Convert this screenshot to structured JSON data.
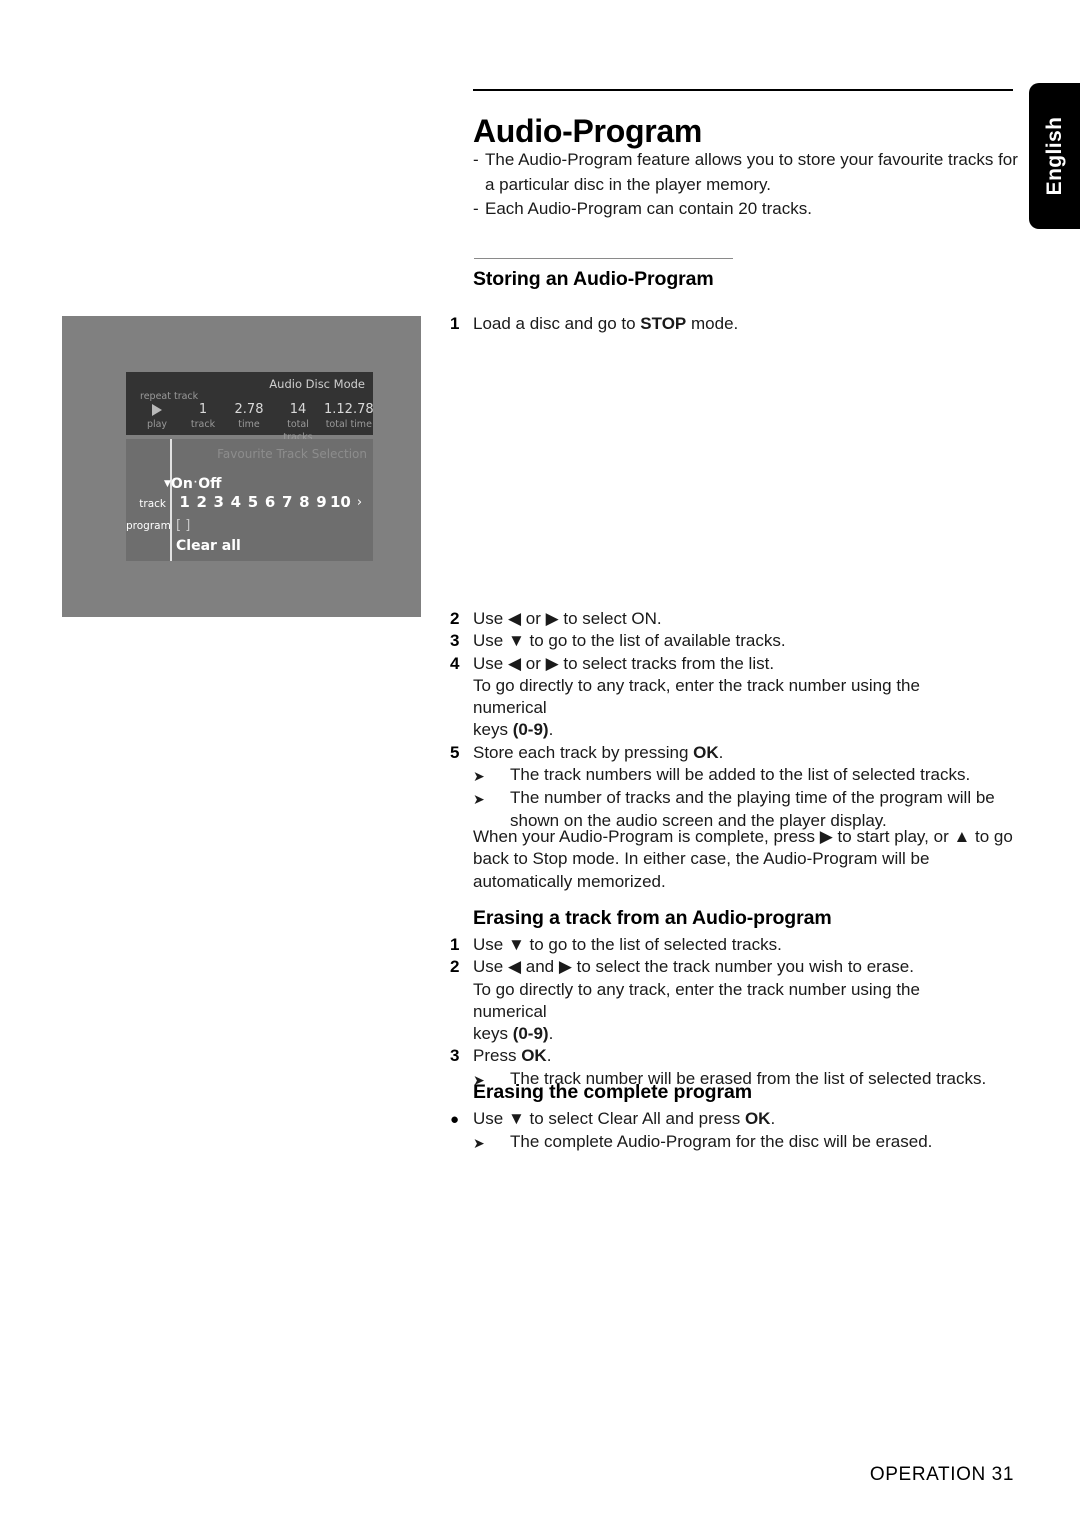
{
  "side_tab": {
    "language": "English"
  },
  "page": {
    "title": "Audio-Program",
    "footer": "OPERATION 31"
  },
  "intro": {
    "bullets": [
      "The Audio-Program feature allows you to store your favourite tracks for a particular disc in the player memory.",
      "Each Audio-Program can contain 20 tracks."
    ],
    "dash": "-"
  },
  "sections": {
    "storing": {
      "heading": "Storing an Audio-Program",
      "steps": [
        {
          "num": "1",
          "text": "Load a disc and go to STOP mode."
        },
        {
          "num": "2",
          "text": "Use ◀ or ▶ to select ON."
        },
        {
          "num": "3",
          "text": "Use ▼ to go to the list of available tracks."
        },
        {
          "num": "4",
          "text": "Use ◀ or ▶ to select tracks from the list."
        },
        {
          "num": "5",
          "text": "Store each track by pressing OK."
        }
      ],
      "step4_continuation_a": "To go directly to any track, enter the track number using the numerical",
      "step4_continuation_b": "keys (0-9).",
      "results": [
        "The track numbers will be added to the list of selected tracks.",
        "The number of tracks and the playing time of the program will be shown on the audio screen and the player display."
      ],
      "note": "When your Audio-Program is complete, press ▶ to start play, or ▲ to go back to Stop mode. In either case, the Audio-Program will be automatically memorized."
    },
    "erasing_track": {
      "heading": "Erasing a track from an Audio-program",
      "steps": [
        {
          "num": "1",
          "text": "Use ▼ to go to the list of selected tracks."
        },
        {
          "num": "2",
          "text": "Use ◀ and ▶ to select the track number you wish to erase."
        },
        {
          "num": "3",
          "text": "Press OK."
        }
      ],
      "step2_continuation_a": "To go directly to any track, enter the track number using the numerical",
      "step2_continuation_b": "keys (0-9).",
      "results": [
        "The track number will be erased from the list of selected tracks."
      ]
    },
    "erasing_complete": {
      "heading": "Erasing the complete program",
      "bullet": "Use ▼ to select Clear All and press OK.",
      "results": [
        "The complete Audio-Program for the disc will be erased."
      ]
    }
  },
  "illustration": {
    "osd_top": {
      "mode_label": "Audio Disc Mode",
      "repeat_label": "repeat track",
      "columns": [
        {
          "value": "▶",
          "label": "play"
        },
        {
          "value": "1",
          "label": "track"
        },
        {
          "value": "2.78",
          "label": "time"
        },
        {
          "value": "14",
          "label": "total tracks"
        },
        {
          "value": "1.12.78",
          "label": "total time"
        }
      ]
    },
    "osd_bottom": {
      "title": "Favourite Track Selection",
      "on_label": "On",
      "off_label": "Off",
      "track_row_label": "track",
      "program_row_label": "program",
      "track_numbers": [
        "1",
        "2",
        "3",
        "4",
        "5",
        "6",
        "7",
        "8",
        "9",
        "10"
      ],
      "more_arrow": "›",
      "program_value": "[ ]",
      "clear_all_label": "Clear all"
    }
  },
  "colors": {
    "illustration_bg": "#808080",
    "osd_top_bg": "#333333",
    "osd_bottom_bg": "#6e6e6e",
    "tab_bg": "#000000"
  }
}
